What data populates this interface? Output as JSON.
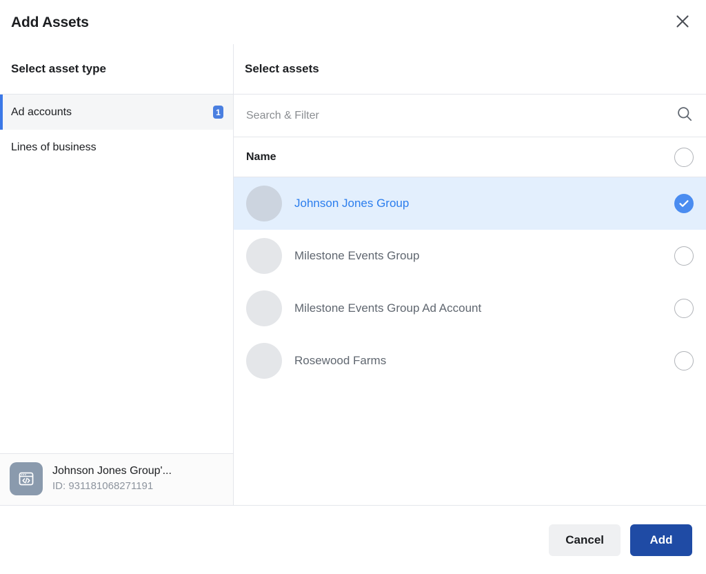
{
  "dialog": {
    "title": "Add Assets",
    "close_label": "Close"
  },
  "left_panel": {
    "heading": "Select asset type",
    "items": [
      {
        "label": "Ad accounts",
        "badge": "1",
        "selected": true
      },
      {
        "label": "Lines of business",
        "badge": "",
        "selected": false
      }
    ],
    "selected_card": {
      "name": "Johnson Jones Group'...",
      "id": "ID: 931181068271191",
      "icon": "browser-code-icon"
    }
  },
  "right_panel": {
    "heading": "Select assets",
    "search": {
      "placeholder": "Search & Filter",
      "value": "",
      "icon": "search-icon"
    },
    "column_header": {
      "name": "Name",
      "select_all_checked": false
    },
    "assets": [
      {
        "name": "Johnson Jones Group",
        "selected": true
      },
      {
        "name": "Milestone Events Group",
        "selected": false
      },
      {
        "name": "Milestone Events Group Ad Account",
        "selected": false
      },
      {
        "name": "Rosewood Farms",
        "selected": false
      }
    ]
  },
  "footer": {
    "cancel_label": "Cancel",
    "add_label": "Add"
  },
  "colors": {
    "accent_blue": "#4a8cf0",
    "primary_button": "#1f4ba5",
    "selected_row_bg": "#e3effd",
    "selected_text": "#2b7ded",
    "badge_blue": "#4a7fe0",
    "rail_blue": "#3b78e7"
  }
}
